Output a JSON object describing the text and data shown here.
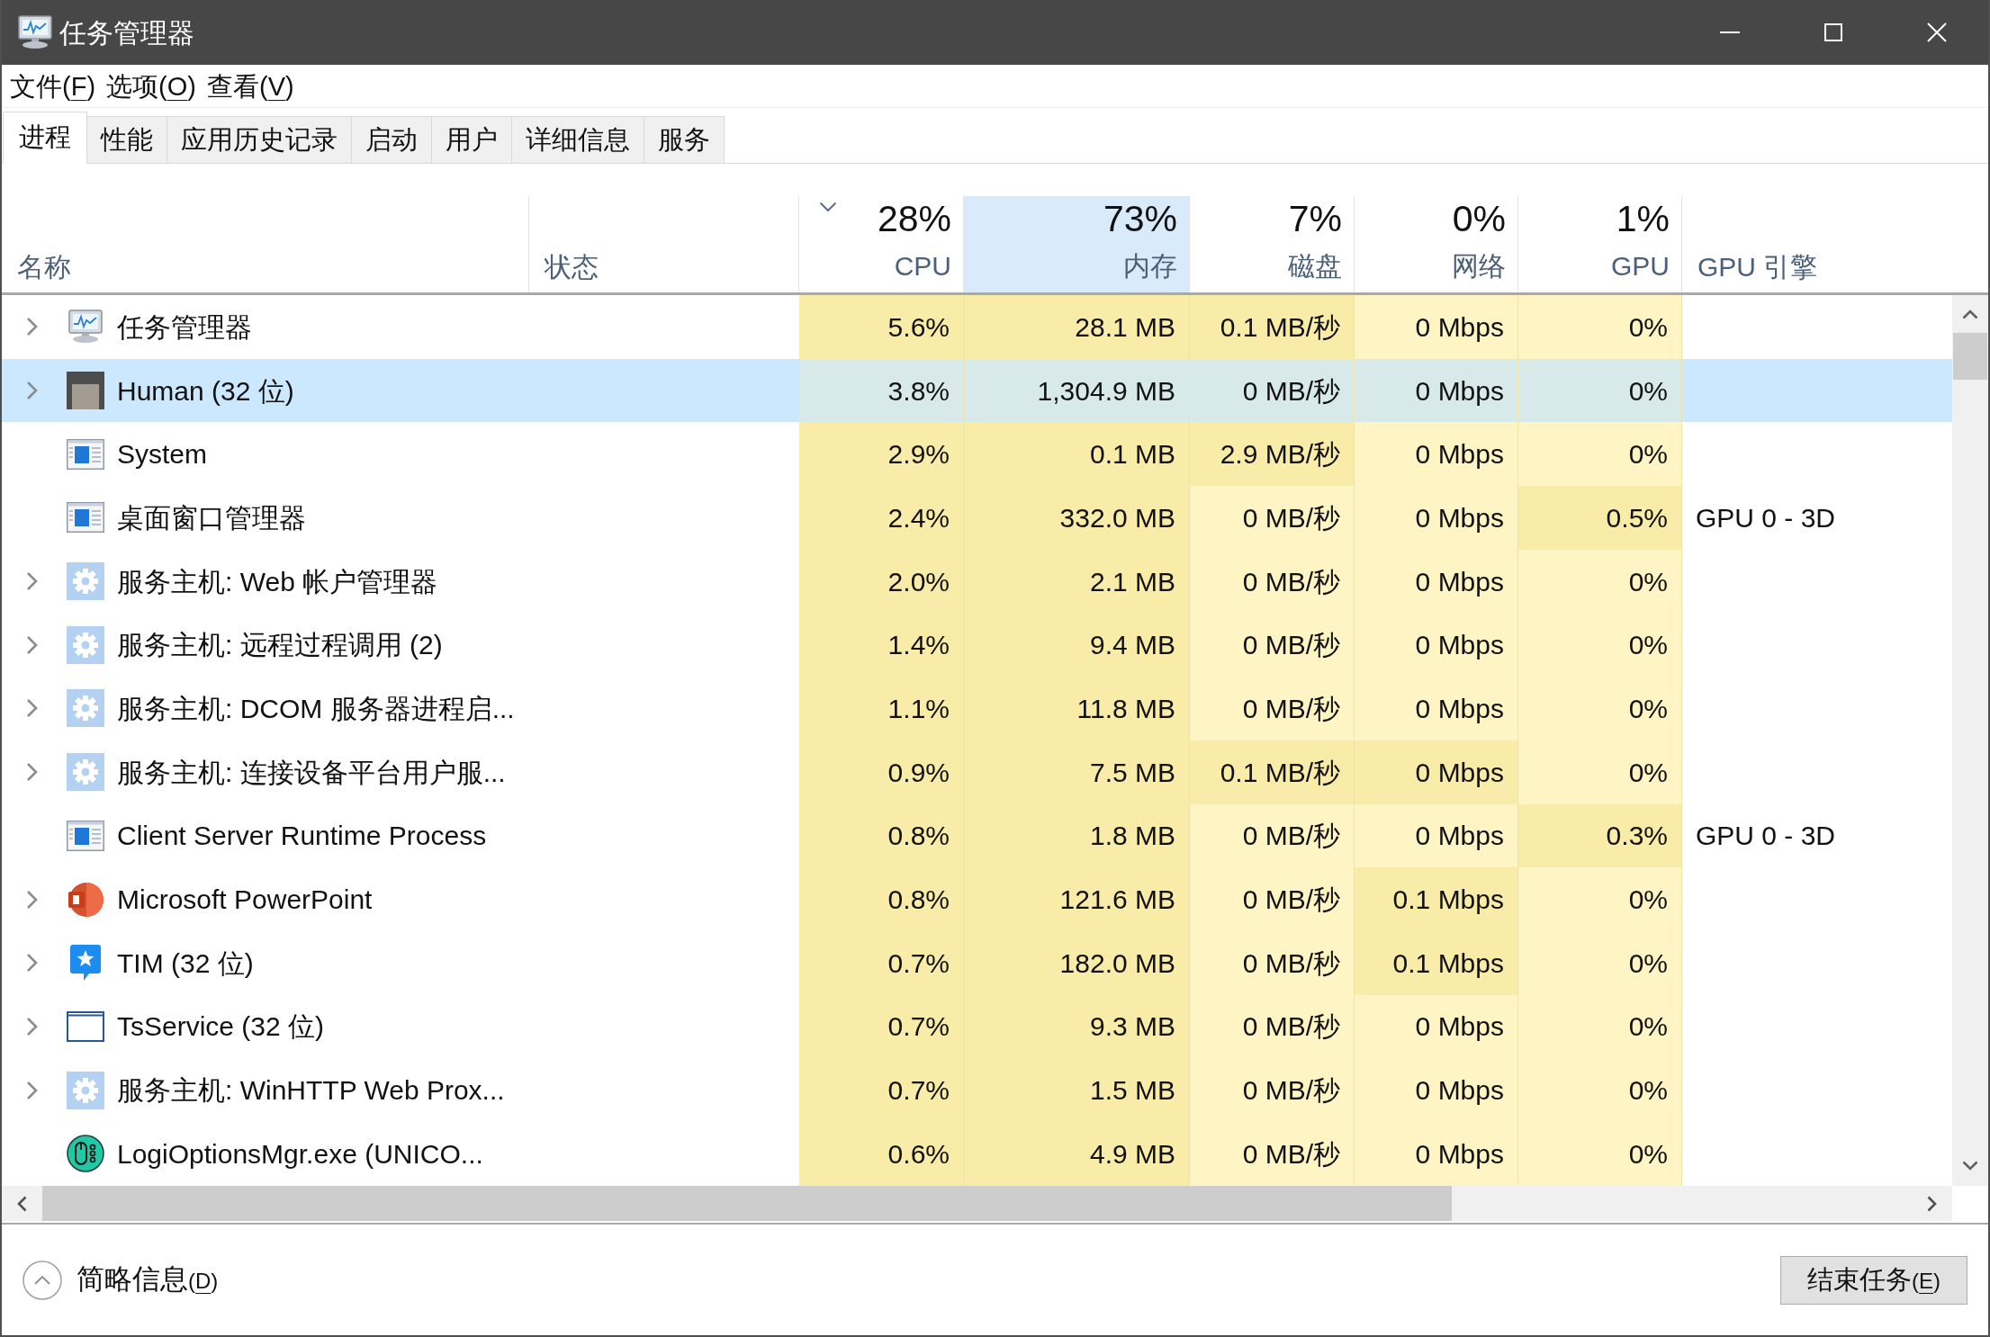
{
  "window": {
    "title": "任务管理器"
  },
  "menu": [
    {
      "segments": [
        {
          "text": "文件(",
          "underline": false
        },
        {
          "text": "F",
          "underline": true
        },
        {
          "text": ")",
          "underline": false
        }
      ]
    },
    {
      "segments": [
        {
          "text": "选项(",
          "underline": false
        },
        {
          "text": "O",
          "underline": true
        },
        {
          "text": ")",
          "underline": false
        }
      ]
    },
    {
      "segments": [
        {
          "text": "查看(",
          "underline": false
        },
        {
          "text": "V",
          "underline": true
        },
        {
          "text": ")",
          "underline": false
        }
      ]
    }
  ],
  "tabs": [
    {
      "label": "进程",
      "selected": true
    },
    {
      "label": "性能",
      "selected": false
    },
    {
      "label": "应用历史记录",
      "selected": false
    },
    {
      "label": "启动",
      "selected": false
    },
    {
      "label": "用户",
      "selected": false
    },
    {
      "label": "详细信息",
      "selected": false
    },
    {
      "label": "服务",
      "selected": false
    }
  ],
  "columns": [
    {
      "kind": "text",
      "label": "名称",
      "sorted": false,
      "highlighted": false
    },
    {
      "kind": "text",
      "label": "状态",
      "sorted": false,
      "highlighted": false
    },
    {
      "kind": "metric",
      "usage": "28%",
      "label": "CPU",
      "sorted": true,
      "highlighted": false
    },
    {
      "kind": "metric",
      "usage": "73%",
      "label": "内存",
      "sorted": false,
      "highlighted": true
    },
    {
      "kind": "metric",
      "usage": "7%",
      "label": "磁盘",
      "sorted": false,
      "highlighted": false
    },
    {
      "kind": "metric",
      "usage": "0%",
      "label": "网络",
      "sorted": false,
      "highlighted": false
    },
    {
      "kind": "metric",
      "usage": "1%",
      "label": "GPU",
      "sorted": false,
      "highlighted": false
    },
    {
      "kind": "text",
      "label": "GPU 引擎",
      "sorted": false,
      "highlighted": false
    }
  ],
  "rows": [
    {
      "kind": "monitor",
      "name": "任务管理器",
      "expandable": true,
      "selected": false,
      "cells": [
        {
          "text": "5.6%",
          "shaded": true
        },
        {
          "text": "28.1 MB",
          "shaded": true
        },
        {
          "text": "0.1 MB/秒",
          "shaded": true
        },
        {
          "text": "0 Mbps",
          "shaded": false
        },
        {
          "text": "0%",
          "shaded": false
        }
      ]
    },
    {
      "kind": "picture",
      "name": "Human (32 位)",
      "expandable": true,
      "selected": true,
      "cells": [
        {
          "text": "3.8%"
        },
        {
          "text": "1,304.9 MB"
        },
        {
          "text": "0 MB/秒"
        },
        {
          "text": "0 Mbps"
        },
        {
          "text": "0%"
        }
      ]
    },
    {
      "kind": "window",
      "name": "System",
      "expandable": false,
      "selected": false,
      "cells": [
        {
          "text": "2.9%",
          "shaded": true
        },
        {
          "text": "0.1 MB",
          "shaded": true
        },
        {
          "text": "2.9 MB/秒",
          "shaded": true
        },
        {
          "text": "0 Mbps",
          "shaded": false
        },
        {
          "text": "0%",
          "shaded": false
        }
      ]
    },
    {
      "kind": "window",
      "name": "桌面窗口管理器",
      "expandable": false,
      "selected": false,
      "cells": [
        {
          "text": "2.4%",
          "shaded": true
        },
        {
          "text": "332.0 MB",
          "shaded": true
        },
        {
          "text": "0 MB/秒",
          "shaded": false
        },
        {
          "text": "0 Mbps",
          "shaded": false
        },
        {
          "text": "0.5%",
          "shaded": true
        }
      ],
      "gpu_engine": "GPU 0 - 3D"
    },
    {
      "kind": "gear",
      "name": "服务主机: Web 帐户管理器",
      "expandable": true,
      "selected": false,
      "cells": [
        {
          "text": "2.0%",
          "shaded": true
        },
        {
          "text": "2.1 MB",
          "shaded": true
        },
        {
          "text": "0 MB/秒",
          "shaded": false
        },
        {
          "text": "0 Mbps",
          "shaded": false
        },
        {
          "text": "0%",
          "shaded": false
        }
      ]
    },
    {
      "kind": "gear",
      "name": "服务主机: 远程过程调用 (2)",
      "expandable": true,
      "selected": false,
      "cells": [
        {
          "text": "1.4%",
          "shaded": true
        },
        {
          "text": "9.4 MB",
          "shaded": true
        },
        {
          "text": "0 MB/秒",
          "shaded": false
        },
        {
          "text": "0 Mbps",
          "shaded": false
        },
        {
          "text": "0%",
          "shaded": false
        }
      ]
    },
    {
      "kind": "gear",
      "name": "服务主机: DCOM 服务器进程启...",
      "expandable": true,
      "selected": false,
      "cells": [
        {
          "text": "1.1%",
          "shaded": true
        },
        {
          "text": "11.8 MB",
          "shaded": true
        },
        {
          "text": "0 MB/秒",
          "shaded": false
        },
        {
          "text": "0 Mbps",
          "shaded": false
        },
        {
          "text": "0%",
          "shaded": false
        }
      ]
    },
    {
      "kind": "gear",
      "name": "服务主机: 连接设备平台用户服...",
      "expandable": true,
      "selected": false,
      "cells": [
        {
          "text": "0.9%",
          "shaded": true
        },
        {
          "text": "7.5 MB",
          "shaded": true
        },
        {
          "text": "0.1 MB/秒",
          "shaded": true
        },
        {
          "text": "0 Mbps",
          "shaded": true
        },
        {
          "text": "0%",
          "shaded": false
        }
      ]
    },
    {
      "kind": "window",
      "name": "Client Server Runtime Process",
      "expandable": false,
      "selected": false,
      "cells": [
        {
          "text": "0.8%",
          "shaded": true
        },
        {
          "text": "1.8 MB",
          "shaded": true
        },
        {
          "text": "0 MB/秒",
          "shaded": false
        },
        {
          "text": "0 Mbps",
          "shaded": false
        },
        {
          "text": "0.3%",
          "shaded": true
        }
      ],
      "gpu_engine": "GPU 0 - 3D"
    },
    {
      "kind": "slides",
      "name": "Microsoft PowerPoint",
      "expandable": true,
      "selected": false,
      "cells": [
        {
          "text": "0.8%",
          "shaded": true
        },
        {
          "text": "121.6 MB",
          "shaded": true
        },
        {
          "text": "0 MB/秒",
          "shaded": false
        },
        {
          "text": "0.1 Mbps",
          "shaded": true
        },
        {
          "text": "0%",
          "shaded": false
        }
      ]
    },
    {
      "kind": "chat",
      "name": "TIM (32 位)",
      "expandable": true,
      "selected": false,
      "cells": [
        {
          "text": "0.7%",
          "shaded": true
        },
        {
          "text": "182.0 MB",
          "shaded": true
        },
        {
          "text": "0 MB/秒",
          "shaded": false
        },
        {
          "text": "0.1 Mbps",
          "shaded": true
        },
        {
          "text": "0%",
          "shaded": false
        }
      ]
    },
    {
      "kind": "frame",
      "name": "TsService (32 位)",
      "expandable": true,
      "selected": false,
      "cells": [
        {
          "text": "0.7%",
          "shaded": true
        },
        {
          "text": "9.3 MB",
          "shaded": true
        },
        {
          "text": "0 MB/秒",
          "shaded": false
        },
        {
          "text": "0 Mbps",
          "shaded": false
        },
        {
          "text": "0%",
          "shaded": false
        }
      ]
    },
    {
      "kind": "gear",
      "name": "服务主机: WinHTTP Web Prox...",
      "expandable": true,
      "selected": false,
      "cells": [
        {
          "text": "0.7%",
          "shaded": true
        },
        {
          "text": "1.5 MB",
          "shaded": true
        },
        {
          "text": "0 MB/秒",
          "shaded": false
        },
        {
          "text": "0 Mbps",
          "shaded": false
        },
        {
          "text": "0%",
          "shaded": false
        }
      ]
    },
    {
      "kind": "mouse",
      "name": "LogiOptionsMgr.exe (UNICO...",
      "expandable": false,
      "selected": false,
      "cells": [
        {
          "text": "0.6%",
          "shaded": true
        },
        {
          "text": "4.9 MB",
          "shaded": true
        },
        {
          "text": "0 MB/秒",
          "shaded": false
        },
        {
          "text": "0 Mbps",
          "shaded": false
        },
        {
          "text": "0%",
          "shaded": false
        }
      ]
    }
  ],
  "footer": {
    "details": {
      "segments": [
        {
          "text": "简略信息",
          "underline": false,
          "small": false
        },
        {
          "text": "(",
          "underline": false,
          "small": true
        },
        {
          "text": "D",
          "underline": true,
          "small": true
        },
        {
          "text": ")",
          "underline": false,
          "small": true
        }
      ]
    },
    "end_task": {
      "segments": [
        {
          "text": "结束任务",
          "underline": false,
          "small": false
        },
        {
          "text": "(",
          "underline": false,
          "small": true
        },
        {
          "text": "E",
          "underline": true,
          "small": true
        },
        {
          "text": ")",
          "underline": false,
          "small": true
        }
      ]
    }
  }
}
